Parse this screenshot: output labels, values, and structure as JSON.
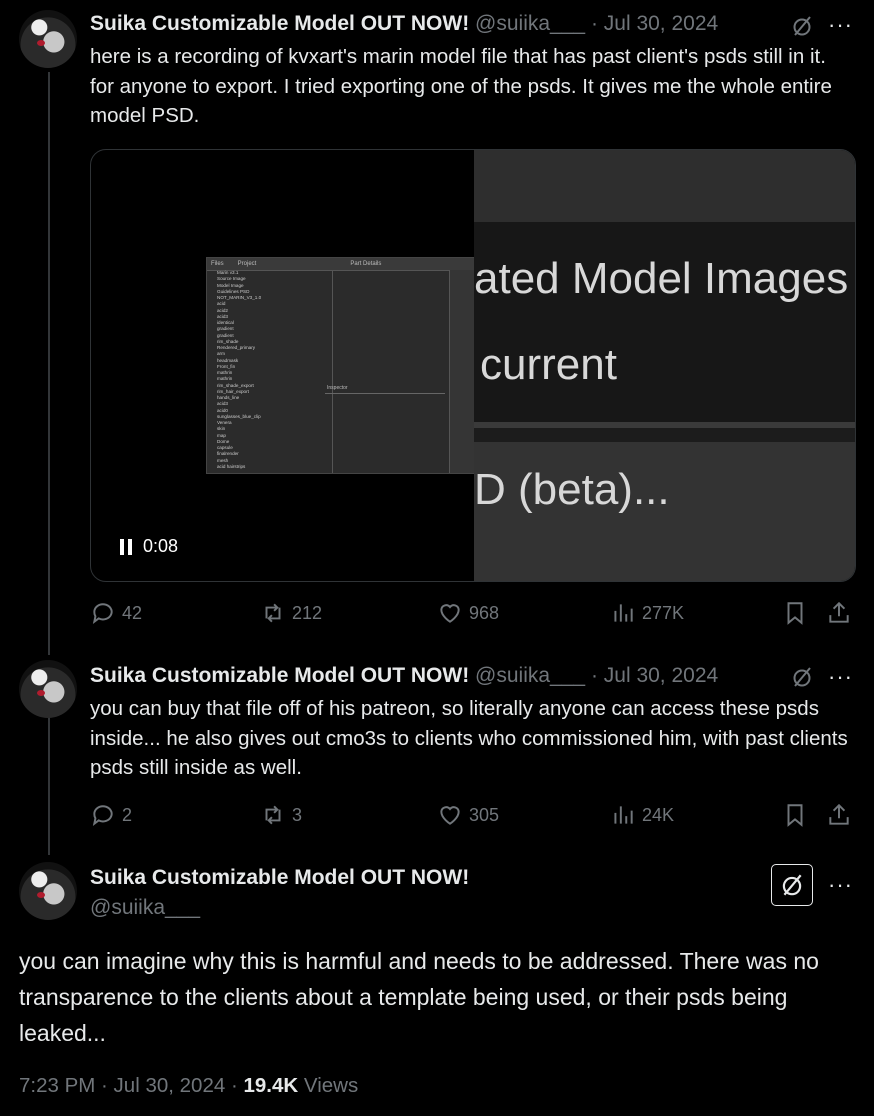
{
  "tweet1": {
    "name": "Suika Customizable Model OUT NOW!",
    "handle": "@suiika___",
    "date": "· Jul 30, 2024",
    "text": "here is a recording of kvxart's marin model file that has past client's psds still in it. for anyone to export.  I tried exporting one of the psds. It gives me the whole entire model PSD.",
    "video": {
      "time": "0:08",
      "overlay_lines": [
        "ated Model Images",
        "current",
        "D (beta)..."
      ],
      "mini_window": {
        "tabs": [
          "Files",
          "Project",
          "Part Details"
        ],
        "tree": [
          "Marin v3.1",
          "Source Image",
          "Model Image",
          "Guidelines PSD",
          "NOT_MARIN_V3_1.0",
          "acid",
          "acid2",
          "acid3",
          "identical",
          "gradient",
          "gradient",
          "rim_shade",
          "Rendered_primary",
          "arm",
          "headmask",
          "Front_fin",
          "mathrin",
          "mathrin",
          "rim_shade_export",
          "rim_hair_export",
          "hands_line",
          "acid3",
          "acid0",
          "sunglasses_blue_clip",
          "Venera",
          "skin",
          "map",
          "Dome",
          "capsule",
          "finalrender",
          "mesh",
          "acid hairstrips"
        ],
        "panel_label": "Inspector"
      }
    },
    "stats": {
      "replies": "42",
      "reposts": "212",
      "likes": "968",
      "views": "277K"
    }
  },
  "tweet2": {
    "name": "Suika Customizable Model OUT NOW!",
    "handle": "@suiika___",
    "date": "· Jul 30, 2024",
    "text": "you can buy that file off of his patreon, so literally anyone can access these psds inside... he also gives out cmo3s to clients who commissioned him, with past clients psds still inside as well.",
    "stats": {
      "replies": "2",
      "reposts": "3",
      "likes": "305",
      "views": "24K"
    }
  },
  "tweet3": {
    "name": "Suika Customizable Model OUT NOW!",
    "handle": "@suiika___",
    "text": "you can imagine why this is harmful and needs to be addressed. There was no transparence to the clients about a template being used, or their psds being leaked...",
    "timestamp": "7:23 PM · Jul 30, 2024 · ",
    "views_count": "19.4K",
    "views_label": " Views"
  },
  "more_label": "···"
}
